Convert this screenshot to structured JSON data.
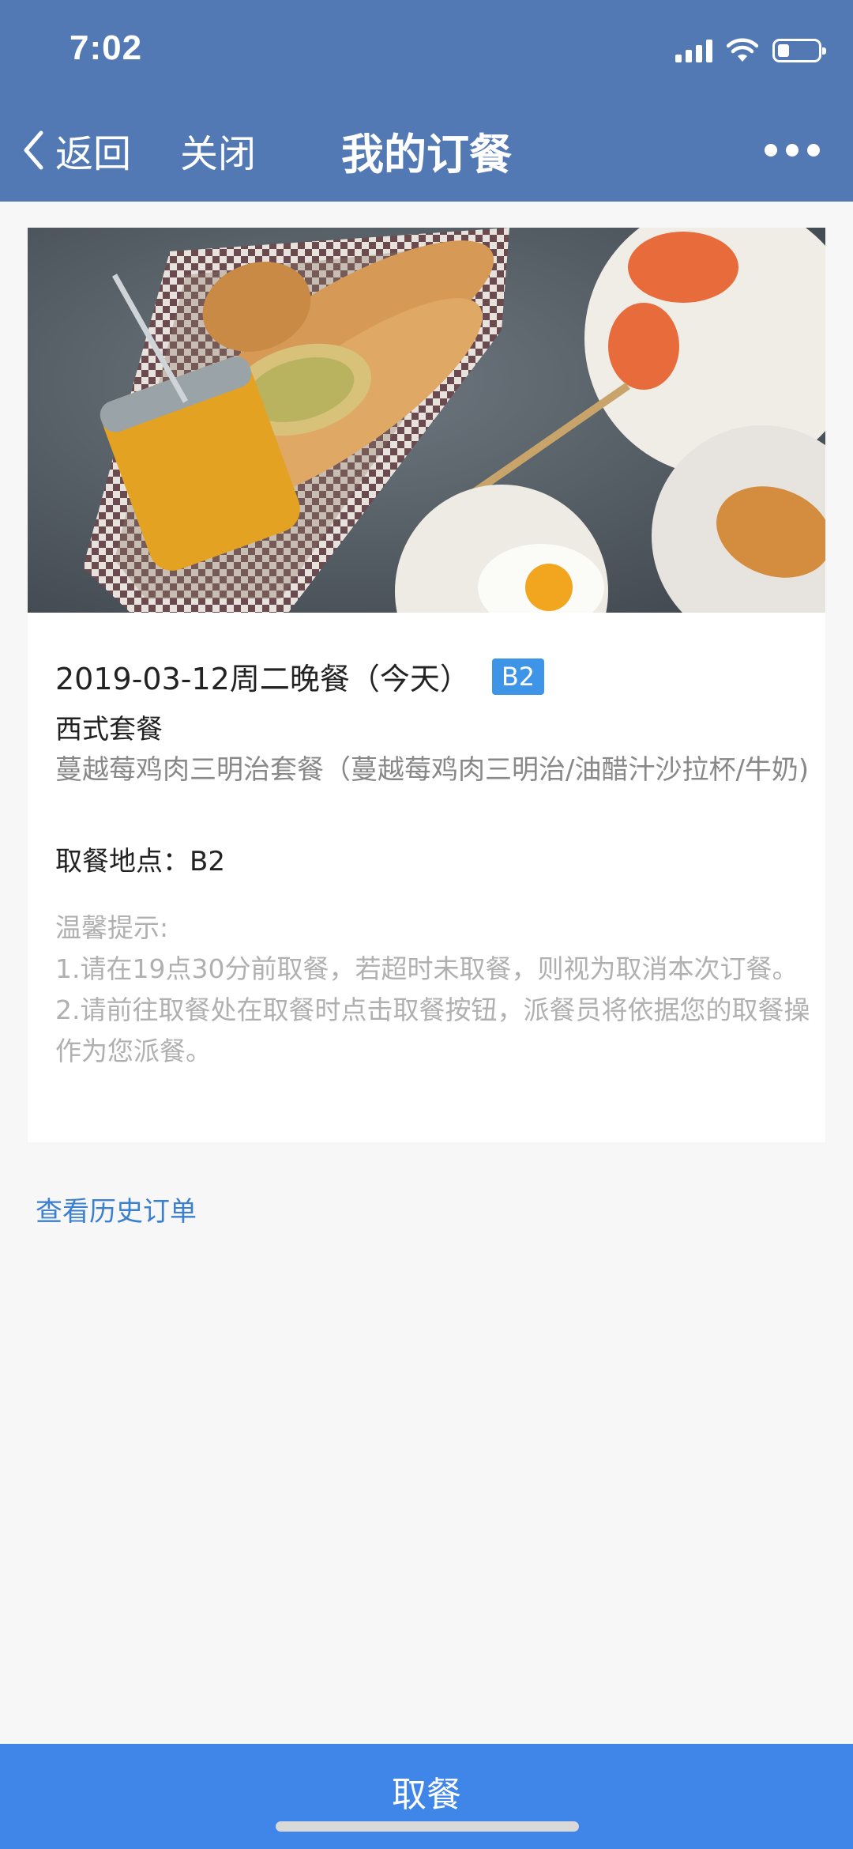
{
  "status_bar": {
    "time": "7:02"
  },
  "nav": {
    "back_label": "返回",
    "close_label": "关闭",
    "title": "我的订餐"
  },
  "order": {
    "date_meal": "2019-03-12周二晚餐（今天）",
    "location_badge": "B2",
    "menu_type": "西式套餐",
    "menu_desc": "蔓越莓鸡肉三明治套餐（蔓越莓鸡肉三明治/油醋汁沙拉杯/牛奶)",
    "pickup_location": "取餐地点：B2",
    "tips": {
      "heading": "温馨提示:",
      "line1": "1.请在19点30分前取餐，若超时未取餐，则视为取消本次订餐。",
      "line2": "2.请前往取餐处在取餐时点击取餐按钮，派餐员将依据您的取餐操作为您派餐。"
    }
  },
  "history_link": "查看历史订单",
  "bottom_button": "取餐",
  "icons": [
    "chevron-left-icon",
    "more-icon",
    "signal-icon",
    "wifi-icon",
    "battery-icon"
  ]
}
